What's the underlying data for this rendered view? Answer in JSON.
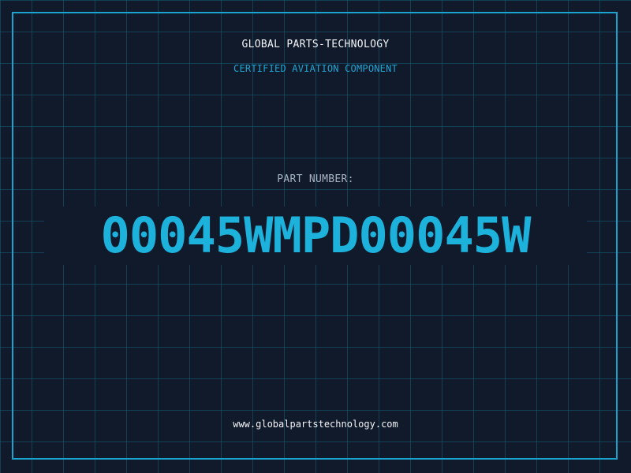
{
  "card": {
    "company_name": "GLOBAL PARTS-TECHNOLOGY",
    "subtitle": "CERTIFIED AVIATION COMPONENT",
    "part_number_label": "PART NUMBER:",
    "part_number": "00045WMPD00045W",
    "website": "www.globalpartstechnology.com"
  },
  "colors": {
    "background": "#111a2b",
    "grid": "#186e8c",
    "accent": "#1cb2dc",
    "text": "#f2f4f8",
    "muted_text": "#a7b4c3"
  }
}
